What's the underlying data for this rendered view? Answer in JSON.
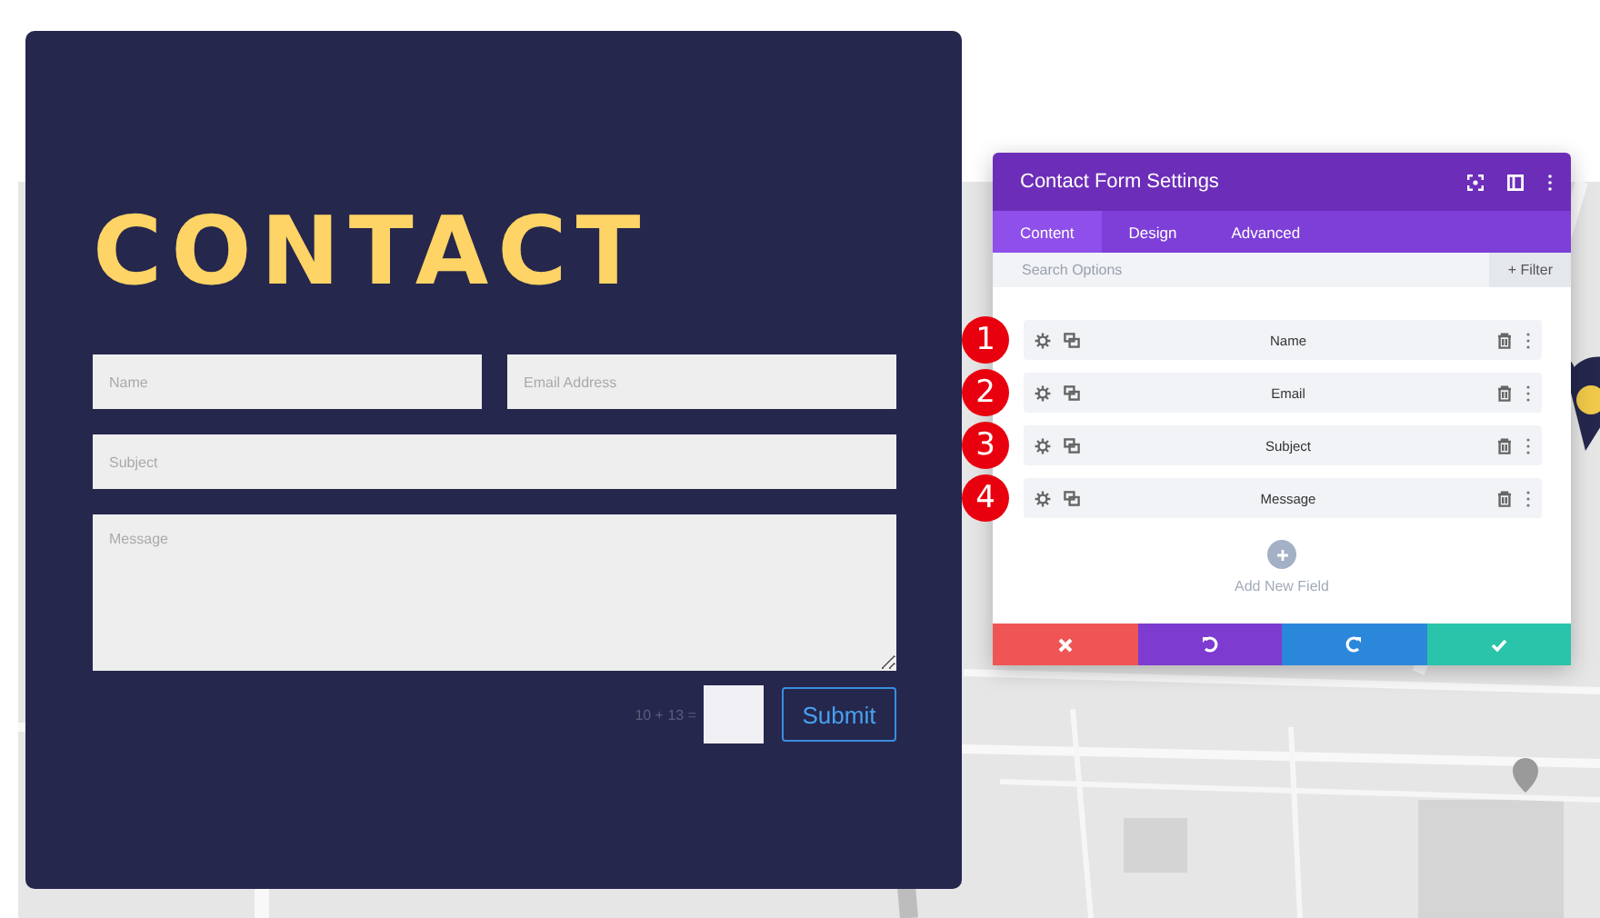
{
  "contact_form": {
    "title": "CONTACT",
    "fields": [
      {
        "placeholder": "Name",
        "kind": "input"
      },
      {
        "placeholder": "Email Address",
        "kind": "input"
      },
      {
        "placeholder": "Subject",
        "kind": "input"
      },
      {
        "placeholder": "Message",
        "kind": "textarea"
      }
    ],
    "captcha": {
      "question": "10 + 13 ="
    },
    "submit": "Submit"
  },
  "settings_panel": {
    "title": "Contact Form Settings",
    "tabs": [
      {
        "label": "Content",
        "selected": true
      },
      {
        "label": "Design",
        "selected": false
      },
      {
        "label": "Advanced",
        "selected": false
      }
    ],
    "search": {
      "placeholder": "Search Options"
    },
    "filter": "+ Filter",
    "fields": [
      {
        "badge": "1",
        "label": "Name"
      },
      {
        "badge": "2",
        "label": "Email"
      },
      {
        "badge": "3",
        "label": "Subject"
      },
      {
        "badge": "4",
        "label": "Message"
      }
    ],
    "add_field": "Add New Field",
    "actions": [
      {
        "kind": "discard"
      },
      {
        "kind": "undo"
      },
      {
        "kind": "redo"
      },
      {
        "kind": "save"
      }
    ]
  }
}
